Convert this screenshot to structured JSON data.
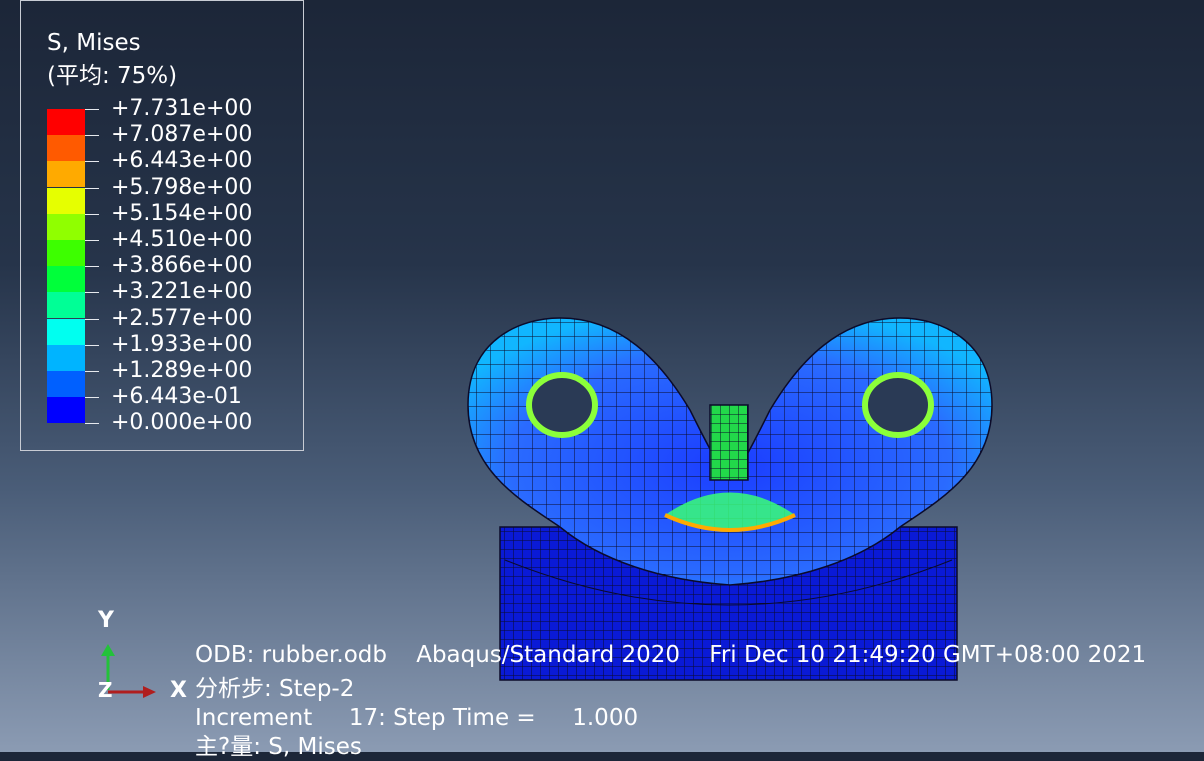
{
  "legend": {
    "title": "S, Mises",
    "subtitle": "(平均: 75%)",
    "values": [
      "+7.731e+00",
      "+7.087e+00",
      "+6.443e+00",
      "+5.798e+00",
      "+5.154e+00",
      "+4.510e+00",
      "+3.866e+00",
      "+3.221e+00",
      "+2.577e+00",
      "+1.933e+00",
      "+1.289e+00",
      "+6.443e-01",
      "+0.000e+00"
    ],
    "colors": [
      "#ff0000",
      "#ff5a00",
      "#ffaa00",
      "#e6ff00",
      "#90ff00",
      "#3dff00",
      "#00ff3a",
      "#00ff96",
      "#00fff0",
      "#00b4ff",
      "#0060ff",
      "#0000ff"
    ]
  },
  "triad": {
    "x": "X",
    "y": "Y",
    "z": "Z"
  },
  "info": {
    "line1": "ODB: rubber.odb    Abaqus/Standard 2020    Fri Dec 10 21:49:20 GMT+08:00 2021",
    "line2": "分析步: Step-2",
    "line3": "Increment     17: Step Time =     1.000",
    "line4": "主?量: S, Mises"
  },
  "colors": {
    "model_blue": "#1e3cff",
    "model_dark": "#0a14c8",
    "mesh": "#0b0b2a"
  }
}
